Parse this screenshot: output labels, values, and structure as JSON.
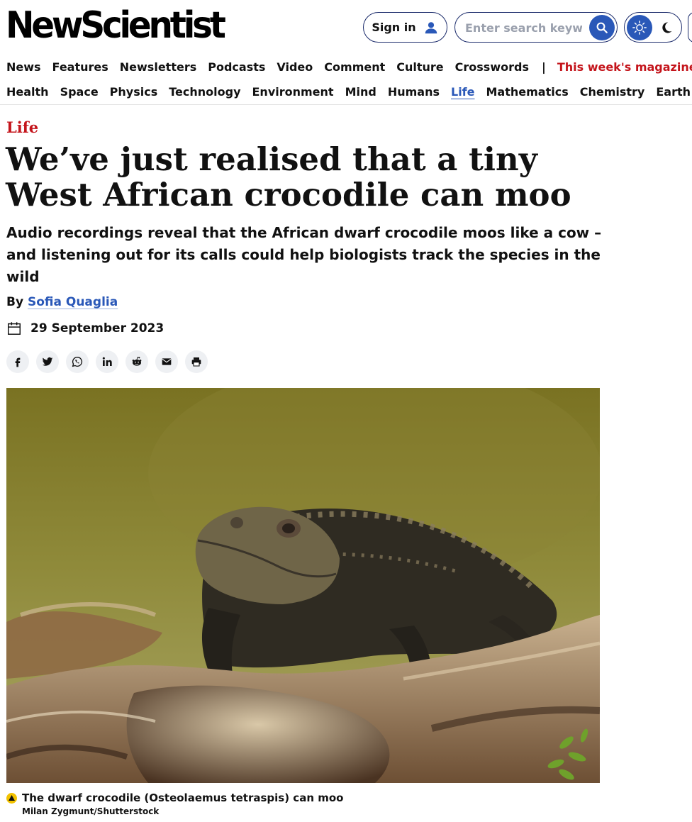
{
  "header": {
    "logo_text": "NewScientist",
    "sign_in_label": "Sign in",
    "search_placeholder": "Enter search keywords",
    "accent_color": "#2a58b8"
  },
  "nav_primary": {
    "items": [
      "News",
      "Features",
      "Newsletters",
      "Podcasts",
      "Video",
      "Comment",
      "Culture",
      "Crosswords"
    ],
    "separator": "|",
    "magazine_link": "This week's magazine"
  },
  "nav_topics": {
    "items": [
      "Health",
      "Space",
      "Physics",
      "Technology",
      "Environment",
      "Mind",
      "Humans",
      "Life",
      "Mathematics",
      "Chemistry",
      "Earth"
    ],
    "active": "Life"
  },
  "article": {
    "section": "Life",
    "headline": "We’ve just realised that a tiny West African crocodile can moo",
    "standfirst": "Audio recordings reveal that the African dwarf crocodile moos like a cow – and listening out for its calls could help biologists track the species in the wild",
    "byline_prefix": "By",
    "author": "Sofia Quaglia",
    "date": "29 September 2023",
    "share_buttons": [
      "facebook-icon",
      "twitter-icon",
      "whatsapp-icon",
      "linkedin-icon",
      "reddit-icon",
      "email-icon",
      "print-icon"
    ],
    "image_caption": "The dwarf crocodile (Osteolaemus tetraspis) can moo",
    "image_credit": "Milan Zygmunt/Shutterstock"
  }
}
